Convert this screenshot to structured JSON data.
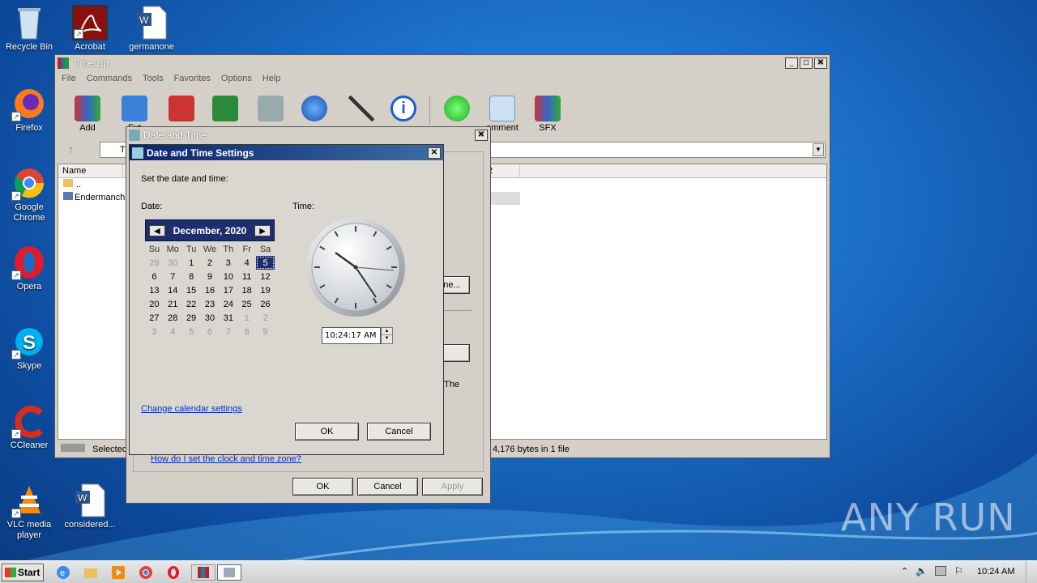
{
  "desktop": {
    "icons": [
      {
        "label": "Recycle Bin",
        "icon": "recycle-bin-icon"
      },
      {
        "label": "Acrobat",
        "icon": "acrobat-icon"
      },
      {
        "label": "germanone",
        "icon": "word-doc-icon"
      },
      {
        "label": "Firefox",
        "icon": "firefox-icon"
      },
      {
        "label": "Google Chrome",
        "icon": "chrome-icon"
      },
      {
        "label": "Opera",
        "icon": "opera-icon"
      },
      {
        "label": "Skype",
        "icon": "skype-icon"
      },
      {
        "label": "CCleaner",
        "icon": "ccleaner-icon"
      },
      {
        "label": "VLC media player",
        "icon": "vlc-icon"
      },
      {
        "label": "considered...",
        "icon": "word-doc-icon"
      }
    ],
    "watermark": "ANY RUN"
  },
  "winrar": {
    "title": "Time.zip",
    "menu": [
      "File",
      "Commands",
      "Tools",
      "Favorites",
      "Options",
      "Help"
    ],
    "toolbar": [
      {
        "label": "Add"
      },
      {
        "label": "Ext"
      },
      {
        "label": ""
      },
      {
        "label": ""
      },
      {
        "label": ""
      },
      {
        "label": ""
      },
      {
        "label": ""
      },
      {
        "label": ""
      },
      {
        "label": ""
      },
      {
        "label": "omment"
      },
      {
        "label": "SFX"
      }
    ],
    "path_partial": "Ti",
    "column_name": "Name",
    "column2_partial": "2",
    "rows": [
      "..",
      "Endermanch"
    ],
    "status_left": "Selected",
    "status_right": "4,176 bytes in 1 file"
  },
  "datetime": {
    "title": "Date and Time",
    "behind_button": "ne...",
    "behind_text": "The",
    "link": "How do I set the clock and time zone?",
    "ok": "OK",
    "cancel": "Cancel",
    "apply": "Apply"
  },
  "settings": {
    "title": "Date and Time Settings",
    "prompt": "Set the date and time:",
    "date_label": "Date:",
    "time_label": "Time:",
    "month": "December, 2020",
    "weekdays": [
      "Su",
      "Mo",
      "Tu",
      "We",
      "Th",
      "Fr",
      "Sa"
    ],
    "weeks": [
      [
        "29",
        "30",
        "1",
        "2",
        "3",
        "4",
        "5"
      ],
      [
        "6",
        "7",
        "8",
        "9",
        "10",
        "11",
        "12"
      ],
      [
        "13",
        "14",
        "15",
        "16",
        "17",
        "18",
        "19"
      ],
      [
        "20",
        "21",
        "22",
        "23",
        "24",
        "25",
        "26"
      ],
      [
        "27",
        "28",
        "29",
        "30",
        "31",
        "1",
        "2"
      ],
      [
        "3",
        "4",
        "5",
        "6",
        "7",
        "8",
        "9"
      ]
    ],
    "selected": "5",
    "time_value": "10:24:17 AM",
    "calendar_link": "Change calendar settings",
    "ok": "OK",
    "cancel": "Cancel"
  },
  "taskbar": {
    "start": "Start",
    "clock": "10:24 AM"
  }
}
